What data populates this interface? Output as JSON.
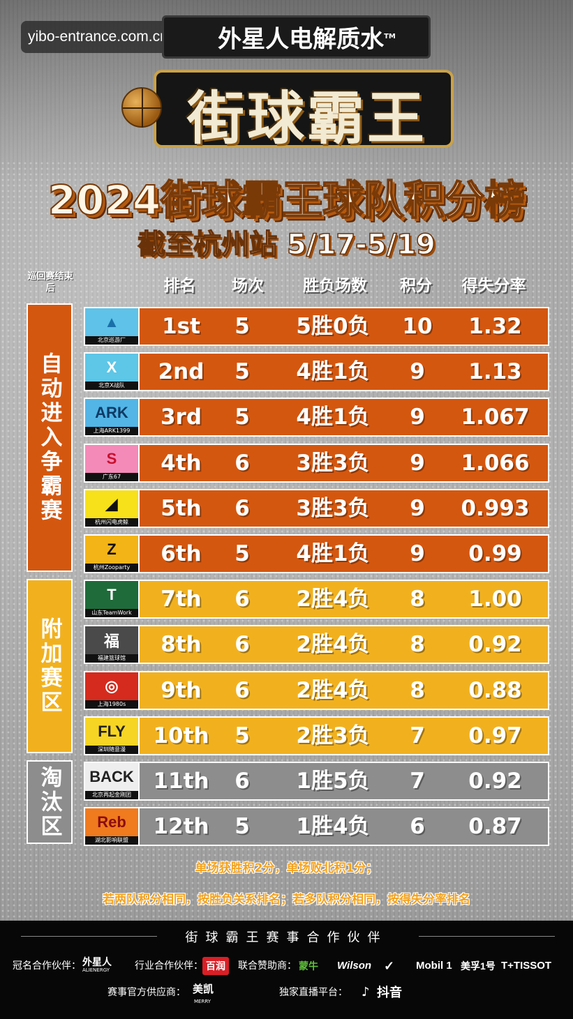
{
  "watermark": "yibo-entrance.com.cn",
  "sponsor_banner": {
    "text": "外星人电解质水",
    "tm": "TM"
  },
  "logo_text": "街球霸王",
  "main_title": "2024街球霸王球队积分榜",
  "subtitle": "截至杭州站 5/17-5/19",
  "note_left": "巡回赛结束后",
  "columns": [
    "排名",
    "场次",
    "胜负场数",
    "积分",
    "得失分率"
  ],
  "groups": [
    {
      "label": "自动进入争霸赛",
      "color": "#d4570f"
    },
    {
      "label": "附加赛区",
      "color": "#f1b11f"
    },
    {
      "label": "淘汰区",
      "color": "#8d8d8d"
    }
  ],
  "teams": [
    {
      "rank": "1st",
      "games": "5",
      "wl": "5胜0负",
      "pts": "10",
      "ratio": "1.32",
      "team": "北京巡游厂",
      "logo": "▲",
      "logo_color": "#1a6fa8",
      "logo_bg": "#5fc2e8",
      "tier": "orange"
    },
    {
      "rank": "2nd",
      "games": "5",
      "wl": "4胜1负",
      "pts": "9",
      "ratio": "1.13",
      "team": "北京X战队",
      "logo": "X",
      "logo_color": "#ffffff",
      "logo_bg": "#5ec6e6",
      "tier": "orange"
    },
    {
      "rank": "3rd",
      "games": "5",
      "wl": "4胜1负",
      "pts": "9",
      "ratio": "1.067",
      "team": "上海ARK1399",
      "logo": "ARK",
      "logo_color": "#0e3b66",
      "logo_bg": "#52b5e6",
      "tier": "orange"
    },
    {
      "rank": "4th",
      "games": "6",
      "wl": "3胜3负",
      "pts": "9",
      "ratio": "1.066",
      "team": "广东67",
      "logo": "S",
      "logo_color": "#c8102e",
      "logo_bg": "#f48ab8",
      "tier": "orange"
    },
    {
      "rank": "5th",
      "games": "6",
      "wl": "3胜3负",
      "pts": "9",
      "ratio": "0.993",
      "team": "杭州闪电虎鲸",
      "logo": "◢",
      "logo_color": "#111111",
      "logo_bg": "#f7e11a",
      "tier": "orange"
    },
    {
      "rank": "6th",
      "games": "5",
      "wl": "4胜1负",
      "pts": "9",
      "ratio": "0.99",
      "team": "杭州Zooparty",
      "logo": "Z",
      "logo_color": "#111111",
      "logo_bg": "#f3b417",
      "tier": "orange"
    },
    {
      "rank": "7th",
      "games": "6",
      "wl": "2胜4负",
      "pts": "8",
      "ratio": "1.00",
      "team": "山东TeamWork",
      "logo": "T",
      "logo_color": "#ffffff",
      "logo_bg": "#1f6b3a",
      "tier": "yellow"
    },
    {
      "rank": "8th",
      "games": "6",
      "wl": "2胜4负",
      "pts": "8",
      "ratio": "0.92",
      "team": "福建篮球馆",
      "logo": "福",
      "logo_color": "#ffffff",
      "logo_bg": "#4a4a4a",
      "tier": "yellow"
    },
    {
      "rank": "9th",
      "games": "6",
      "wl": "2胜4负",
      "pts": "8",
      "ratio": "0.88",
      "team": "上海1980s",
      "logo": "◎",
      "logo_color": "#ffffff",
      "logo_bg": "#d52b1e",
      "tier": "yellow"
    },
    {
      "rank": "10th",
      "games": "5",
      "wl": "2胜3负",
      "pts": "7",
      "ratio": "0.97",
      "team": "深圳随意漫",
      "logo": "FLY",
      "logo_color": "#222222",
      "logo_bg": "#f7d524",
      "tier": "yellow"
    },
    {
      "rank": "11th",
      "games": "6",
      "wl": "1胜5负",
      "pts": "7",
      "ratio": "0.92",
      "team": "北京再起金刚团",
      "logo": "BACK",
      "logo_color": "#222222",
      "logo_bg": "#eeeeee",
      "tier": "gray"
    },
    {
      "rank": "12th",
      "games": "5",
      "wl": "1胜4负",
      "pts": "6",
      "ratio": "0.87",
      "team": "湖北影响联盟",
      "logo": "Reb",
      "logo_color": "#8b0d0d",
      "logo_bg": "#f07a1e",
      "tier": "gray"
    }
  ],
  "rules": [
    "单场获胜积2分，单场败北积1分；",
    "若两队积分相同，按胜负关系排名；若多队积分相同，按得失分率排名"
  ],
  "footer": {
    "title": "街球霸王赛事合作伙伴",
    "title_sponsor_label": "冠名合作伙伴：",
    "title_sponsor": "外星人",
    "title_sponsor_sub": "ALIENERGY",
    "industry_label": "行业合作伙伴：",
    "industry_partner": "百润",
    "co_sponsor_label": "联合赞助商：",
    "co_sponsors": [
      "蒙牛",
      "Wilson",
      "✓",
      "Mobil 1",
      "美孚1号",
      "T+TISSOT"
    ],
    "supplier_label": "赛事官方供应商：",
    "supplier": "美凯",
    "supplier_sub": "MERRY",
    "broadcast_label": "独家直播平台：",
    "broadcast": "抖音"
  }
}
